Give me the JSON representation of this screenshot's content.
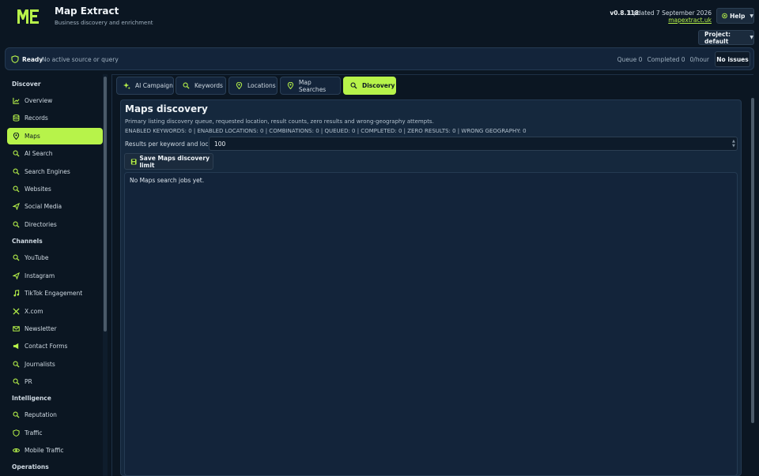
{
  "app": {
    "title": "Map Extract",
    "subtitle": "Business discovery and enrichment",
    "version": "v0.8.118",
    "updated": "Updated 7 September 2026",
    "site_link": "mapextract.uk",
    "help_label": "Help",
    "project_label": "Project: default",
    "accent_color": "#b7f34a"
  },
  "status": {
    "state": "Ready",
    "message": "No active source or query",
    "queue": "Queue 0",
    "completed": "Completed 0",
    "rate": "0/hour",
    "issues_label": "No issues"
  },
  "sidebar": {
    "sections": [
      {
        "label": "Discover"
      },
      {
        "label": "Channels"
      },
      {
        "label": "Intelligence"
      },
      {
        "label": "Operations"
      }
    ],
    "items": [
      {
        "label": "Overview",
        "icon": "chart-line-icon"
      },
      {
        "label": "Records",
        "icon": "database-icon"
      },
      {
        "label": "Maps",
        "icon": "map-pin-icon",
        "active": true
      },
      {
        "label": "AI Search",
        "icon": "search-icon"
      },
      {
        "label": "Search Engines",
        "icon": "search-icon"
      },
      {
        "label": "Websites",
        "icon": "search-icon"
      },
      {
        "label": "Social Media",
        "icon": "share-icon"
      },
      {
        "label": "Directories",
        "icon": "search-icon"
      },
      {
        "label": "YouTube",
        "icon": "search-icon"
      },
      {
        "label": "Instagram",
        "icon": "share-icon"
      },
      {
        "label": "TikTok Engagement",
        "icon": "music-note-icon"
      },
      {
        "label": "X.com",
        "icon": "x-logo-icon"
      },
      {
        "label": "Newsletter",
        "icon": "mail-icon"
      },
      {
        "label": "Contact Forms",
        "icon": "megaphone-icon"
      },
      {
        "label": "Journalists",
        "icon": "search-icon"
      },
      {
        "label": "PR",
        "icon": "search-icon"
      },
      {
        "label": "Reputation",
        "icon": "search-icon"
      },
      {
        "label": "Traffic",
        "icon": "shield-icon"
      },
      {
        "label": "Mobile Traffic",
        "icon": "eye-icon"
      }
    ]
  },
  "tabs": [
    {
      "label": "AI Campaign",
      "icon": "sparkle-icon"
    },
    {
      "label": "Keywords",
      "icon": "search-icon"
    },
    {
      "label": "Locations",
      "icon": "map-pin-icon"
    },
    {
      "label": "Map Searches",
      "icon": "map-pin-icon"
    },
    {
      "label": "Discovery",
      "icon": "search-icon",
      "active": true
    }
  ],
  "panel": {
    "title": "Maps discovery",
    "description": "Primary listing discovery queue, requested location, result counts, zero results and wrong-geography attempts.",
    "stats": "ENABLED KEYWORDS: 0 | ENABLED LOCATIONS: 0 | COMBINATIONS: 0 | QUEUED: 0 | COMPLETED: 0 | ZERO RESULTS: 0 | WRONG GEOGRAPHY: 0",
    "results_label": "Results per keyword and location",
    "results_value": "100",
    "save_label": "Save Maps discovery limit",
    "jobs_empty": "No Maps search jobs yet."
  }
}
